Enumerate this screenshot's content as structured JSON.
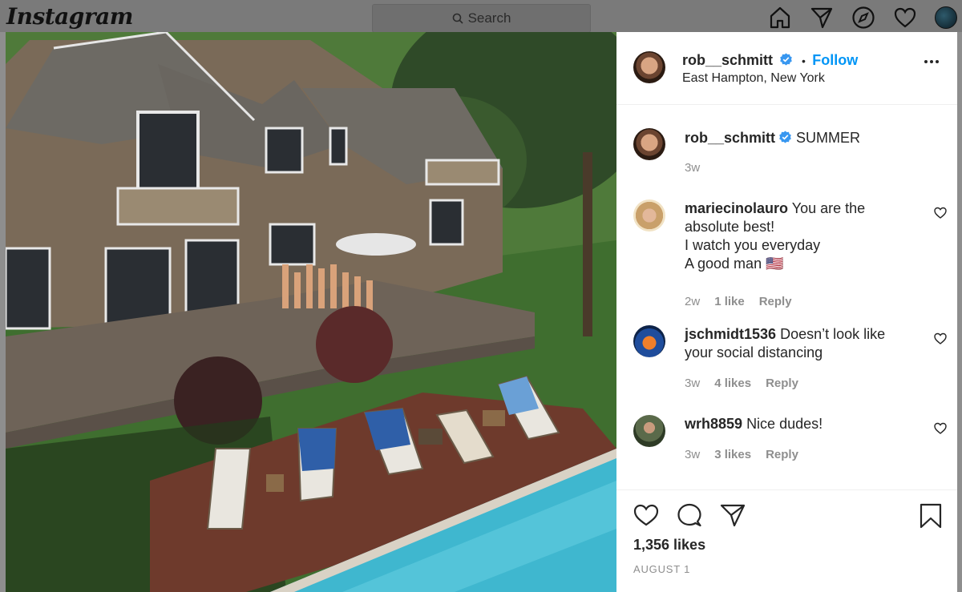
{
  "nav": {
    "logo": "Instagram",
    "search_placeholder": "Search",
    "icons": [
      "home-icon",
      "direct-icon",
      "explore-icon",
      "activity-heart-icon",
      "profile-avatar"
    ]
  },
  "post": {
    "username": "rob__schmitt",
    "follow_label": "Follow",
    "separator": "•",
    "location": "East Hampton, New York",
    "caption": "SUMMER",
    "caption_age": "3w",
    "likes": "1,356 likes",
    "date": "AUGUST 1"
  },
  "comments": [
    {
      "user": "mariecinolauro",
      "lines": [
        "You are the",
        "absolute best!",
        "I watch you everyday",
        "A good man 🇺🇸"
      ],
      "age": "2w",
      "likes": "1 like",
      "reply": "Reply"
    },
    {
      "user": "jschmidt1536",
      "lines": [
        "Doesn’t look like",
        "your social distancing"
      ],
      "age": "3w",
      "likes": "4 likes",
      "reply": "Reply"
    },
    {
      "user": "wrh8859",
      "lines": [
        "Nice dudes!"
      ],
      "age": "3w",
      "likes": "3 likes",
      "reply": "Reply"
    }
  ],
  "colors": {
    "accent": "#0095f6",
    "verified": "#3897f0",
    "muted": "#8e8e8e",
    "overlay": "#8e8e8e"
  }
}
